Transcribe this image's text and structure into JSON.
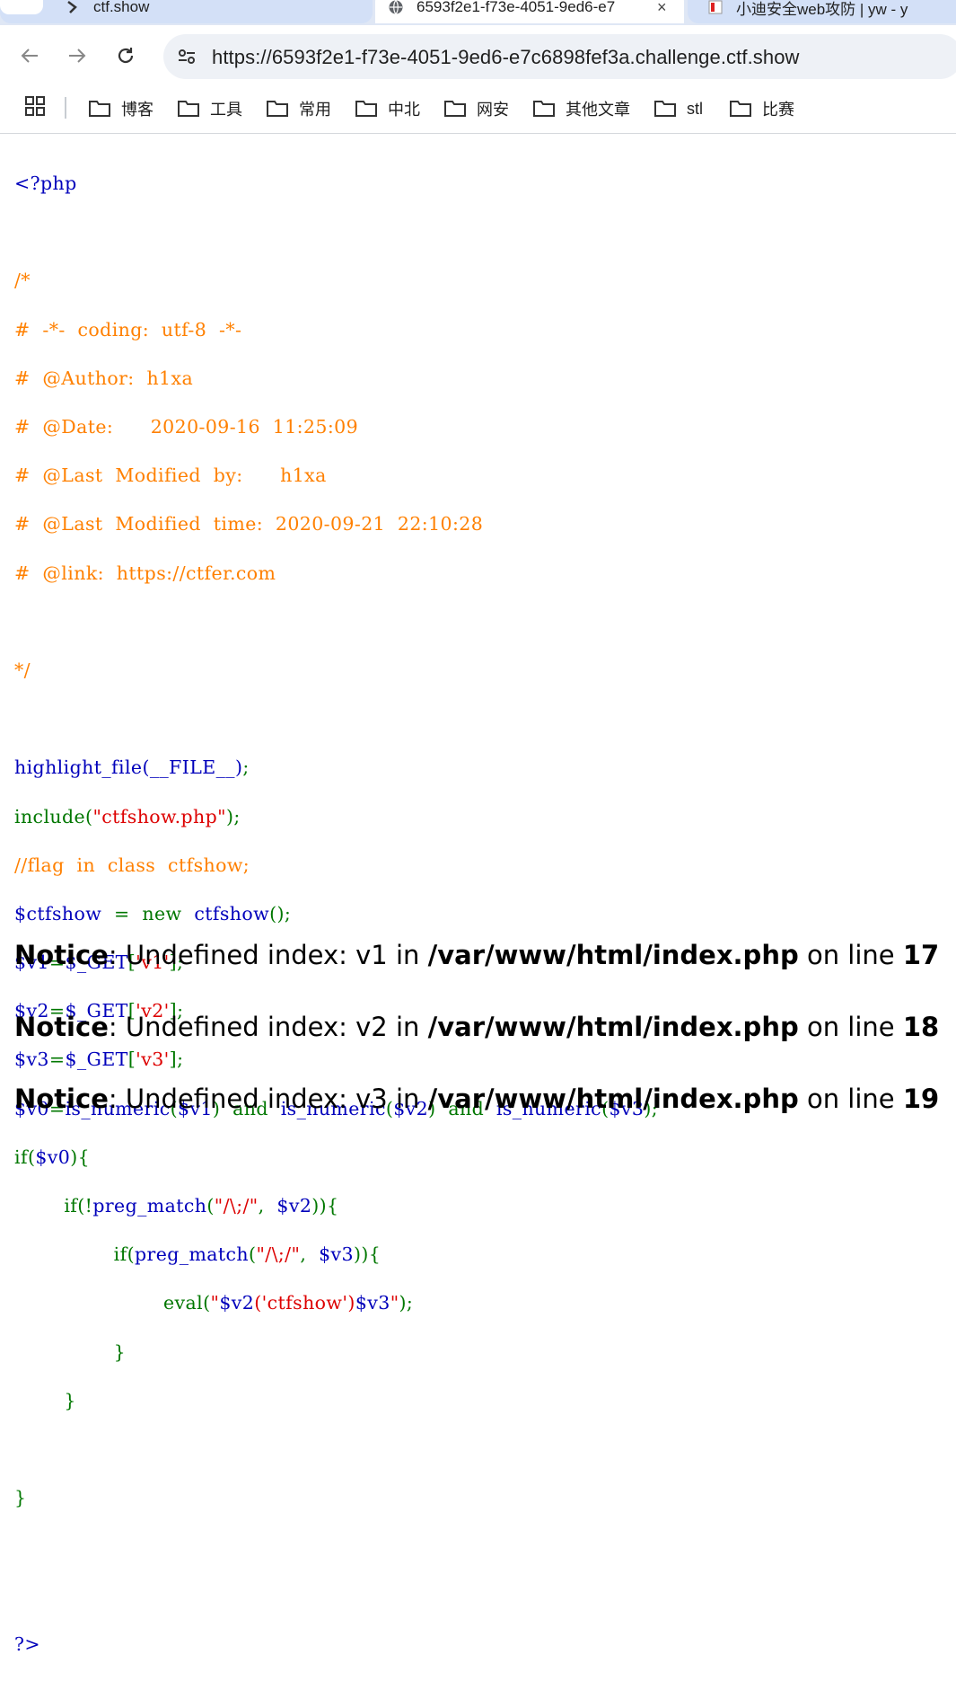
{
  "browser": {
    "tabs": [
      {
        "title": "ctf.show",
        "close": "×"
      },
      {
        "title": "6593f2e1-f73e-4051-9ed6-e7",
        "close": "×"
      },
      {
        "title": "小迪安全web攻防 | yw - y",
        "close": ""
      }
    ],
    "url": "https://6593f2e1-f73e-4051-9ed6-e7c6898fef3a.challenge.ctf.show",
    "bookmarks": [
      "博客",
      "工具",
      "常用",
      "中北",
      "网安",
      "其他文章",
      "stl",
      "比赛"
    ]
  },
  "code": {
    "l1": "<?php",
    "l2": "/*",
    "l3": "#  -*-  coding:  utf-8  -*-",
    "l4": "#  @Author:  h1xa",
    "l5": "#  @Date:      2020-09-16  11:25:09",
    "l6": "#  @Last  Modified  by:      h1xa",
    "l7": "#  @Last  Modified  time:  2020-09-21  22:10:28",
    "l8": "#  @link:  https://ctfer.com",
    "l9": "*/",
    "hl_fn": "highlight_file(__FILE__)",
    "hl_semi": ";",
    "inc_kw": "include(",
    "inc_str": "\"ctfshow.php\"",
    "inc_end": ");",
    "flag_cm": "//flag  in  class  ctfshow;",
    "ctf_var": "$ctfshow  ",
    "ctf_eq": "=  new  ",
    "ctf_cls": "ctfshow",
    "ctf_end": "();",
    "v1_var": "$v1",
    "v1_eq": "=",
    "v1_get": "$_GET",
    "v1_br": "[",
    "v1_str": "'v1'",
    "v1_end": "];",
    "v2_var": "$v2",
    "v2_eq": "=",
    "v2_get": "$_GET",
    "v2_br": "[",
    "v2_str": "'v2'",
    "v2_end": "];",
    "v3_var": "$v3",
    "v3_eq": "=",
    "v3_get": "$_GET",
    "v3_br": "[",
    "v3_str": "'v3'",
    "v3_end": "];",
    "v0_var": "$v0",
    "v0_eq": "=",
    "v0_f1": "is_numeric",
    "v0_p1": "(",
    "v0_a1": "$v1",
    "v0_and1": ")  and  ",
    "v0_f2": "is_numeric",
    "v0_p2": "(",
    "v0_a2": "$v2",
    "v0_and2": ")  and  ",
    "v0_f3": "is_numeric",
    "v0_p3": "(",
    "v0_a3": "$v3",
    "v0_end": ");",
    "if_kw": "if(",
    "if_var": "$v0",
    "if_end": "){",
    "ind1": "        ",
    "if2_kw": "if(!",
    "if2_fn": "preg_match",
    "if2_p": "(",
    "if2_str": "\"/\\;/\"",
    "if2_c": ",  ",
    "if2_var": "$v2",
    "if2_end": ")){",
    "ind2": "                ",
    "if3_kw": "if(",
    "if3_fn": "preg_match",
    "if3_p": "(",
    "if3_str": "\"/\\;/\"",
    "if3_c": ",  ",
    "if3_var": "$v3",
    "if3_end": ")){",
    "ind3": "                        ",
    "ev_kw": "eval(",
    "ev_q1": "\"",
    "ev_v2": "$v2",
    "ev_mid": "('ctfshow')",
    "ev_v3": "$v3",
    "ev_q2": "\"",
    "ev_end": ");",
    "close3": "}",
    "close2": "}",
    "close1": "}",
    "php_end": "?>"
  },
  "notices": [
    {
      "label": "Notice",
      "text": ": Undefined index: v1 in ",
      "path": "/var/www/html/index.php",
      "mid": " on line ",
      "line": "17"
    },
    {
      "label": "Notice",
      "text": ": Undefined index: v2 in ",
      "path": "/var/www/html/index.php",
      "mid": " on line ",
      "line": "18"
    },
    {
      "label": "Notice",
      "text": ": Undefined index: v3 in ",
      "path": "/var/www/html/index.php",
      "mid": " on line ",
      "line": "19"
    }
  ],
  "colors": {
    "default": "#0000bb",
    "keyword": "#007700",
    "comment": "#ff8000",
    "string": "#dd0000"
  }
}
